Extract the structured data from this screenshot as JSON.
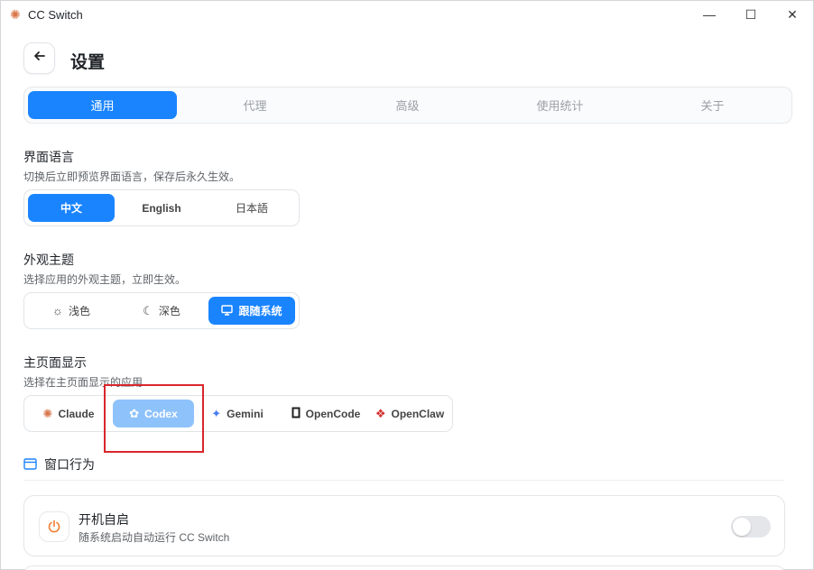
{
  "window": {
    "title": "CC Switch",
    "app_icon": "asterisk-icon"
  },
  "controls": {
    "minimize": "—",
    "maximize": "☐",
    "close": "✕"
  },
  "header": {
    "back_icon": "arrow-left-icon",
    "title": "设置"
  },
  "tabs": [
    {
      "label": "通用",
      "active": true
    },
    {
      "label": "代理",
      "active": false
    },
    {
      "label": "高级",
      "active": false
    },
    {
      "label": "使用统计",
      "active": false
    },
    {
      "label": "关于",
      "active": false
    }
  ],
  "language": {
    "title": "界面语言",
    "description": "切换后立即预览界面语言，保存后永久生效。",
    "options": [
      {
        "label": "中文",
        "active": true
      },
      {
        "label": "English",
        "active": false
      },
      {
        "label": "日本語",
        "active": false
      }
    ]
  },
  "theme": {
    "title": "外观主题",
    "description": "选择应用的外观主题，立即生效。",
    "options": [
      {
        "label": "浅色",
        "icon": "sun-icon",
        "active": false
      },
      {
        "label": "深色",
        "icon": "moon-icon",
        "active": false
      },
      {
        "label": "跟随系统",
        "icon": "monitor-icon",
        "active": true
      }
    ]
  },
  "homepage": {
    "title": "主页面显示",
    "description": "选择在主页面显示的应用",
    "apps": [
      {
        "label": "Claude",
        "icon": "claude-icon",
        "active": false
      },
      {
        "label": "Codex",
        "icon": "codex-icon",
        "active": true
      },
      {
        "label": "Gemini",
        "icon": "gemini-icon",
        "active": false
      },
      {
        "label": "OpenCode",
        "icon": "opencode-icon",
        "active": false
      },
      {
        "label": "OpenClaw",
        "icon": "openclaw-icon",
        "active": false
      }
    ]
  },
  "window_behavior": {
    "title": "窗口行为",
    "autostart": {
      "title": "开机自启",
      "description": "随系统启动自动运行 CC Switch",
      "enabled": false
    }
  },
  "colors": {
    "accent": "#1a84ff",
    "highlight": "#d9262b",
    "claude": "#d9774b",
    "openclaw": "#d2312f"
  }
}
